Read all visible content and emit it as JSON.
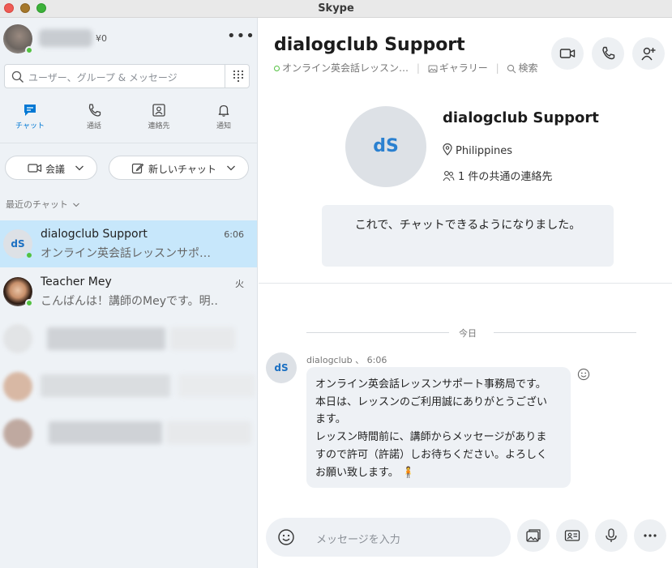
{
  "window": {
    "title": "Skype"
  },
  "me": {
    "credit": "¥0"
  },
  "search": {
    "placeholder": "ユーザー、グループ & メッセージ"
  },
  "nav": {
    "tabs": [
      {
        "label": "チャット",
        "icon": "chat-icon",
        "active": true
      },
      {
        "label": "通話",
        "icon": "phone-icon"
      },
      {
        "label": "連絡先",
        "icon": "contacts-icon"
      },
      {
        "label": "通知",
        "icon": "bell-icon"
      }
    ]
  },
  "actions": {
    "meet_label": "会議",
    "new_chat_label": "新しいチャット"
  },
  "recent": {
    "label": "最近のチャット"
  },
  "chats": [
    {
      "initials": "dS",
      "name": "dialogclub Support",
      "time": "6:06",
      "preview": "オンライン英会話レッスンサポ…",
      "selected": true
    },
    {
      "name": "Teacher Mey",
      "time": "火",
      "preview": "こんばんは！講師のMeyです。明…"
    }
  ],
  "conversation": {
    "title": "dialogclub Support",
    "subtitle_status": "オンライン英会話レッスン…",
    "gallery_label": "ギャラリー",
    "find_label": "検索",
    "profile": {
      "initials": "dS",
      "name": "dialogclub Support",
      "location": "Philippines",
      "mutual_contacts": "1 件の共通の連絡先"
    },
    "system_message": "これで、チャットできるようになりました。",
    "day_label": "今日",
    "message": {
      "initials": "dS",
      "sender": "dialogclub",
      "time": "6:06",
      "lines": [
        "オンライン英会話レッスンサポート事務局です。",
        "本日は、レッスンのご利用誠にありがとうござい",
        "ます。",
        "レッスン時間前に、講師からメッセージがありま",
        "すので許可（許諾）しお待ちください。よろしく",
        "お願い致します。 🧍"
      ]
    },
    "composer": {
      "placeholder": "メッセージを入力"
    }
  },
  "colors": {
    "accent": "#0078d4",
    "selected_row": "#c7e7fb",
    "presence": "#53c141",
    "sidebar_bg": "#eef2f6"
  }
}
